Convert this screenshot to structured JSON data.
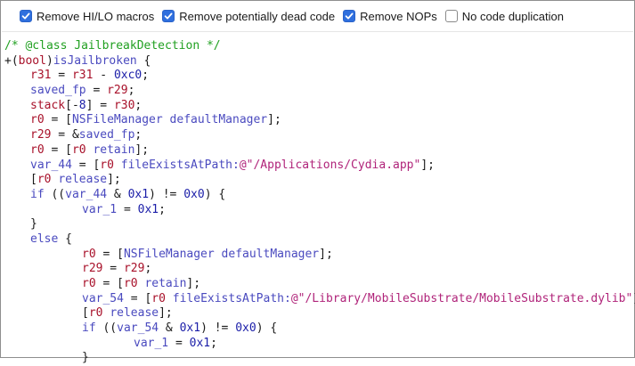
{
  "options": [
    {
      "label": "Remove HI/LO macros",
      "checked": true
    },
    {
      "label": "Remove potentially dead code",
      "checked": true
    },
    {
      "label": "Remove NOPs",
      "checked": true
    },
    {
      "label": "No code duplication",
      "checked": false
    }
  ],
  "code": {
    "class_comment": "/* @class JailbreakDetection */",
    "method_prefix": "+(",
    "method_type": "bool",
    "method_close": ")",
    "method_name": "isJailbroken",
    "method_brace": " {",
    "file_path_1": "\"/Applications/Cydia.app\"",
    "file_path_2": "\"/Library/MobileSubstrate/MobileSubstrate.dylib\""
  },
  "colors": {
    "checkbox_checked": "#2f6fde",
    "comment": "#21a021",
    "register": "#a8112a",
    "number": "#1b1ea8",
    "objc_class_selector": "#4a4abf",
    "string": "#b0247a"
  },
  "icons": {
    "checked": "checkmark-icon"
  }
}
